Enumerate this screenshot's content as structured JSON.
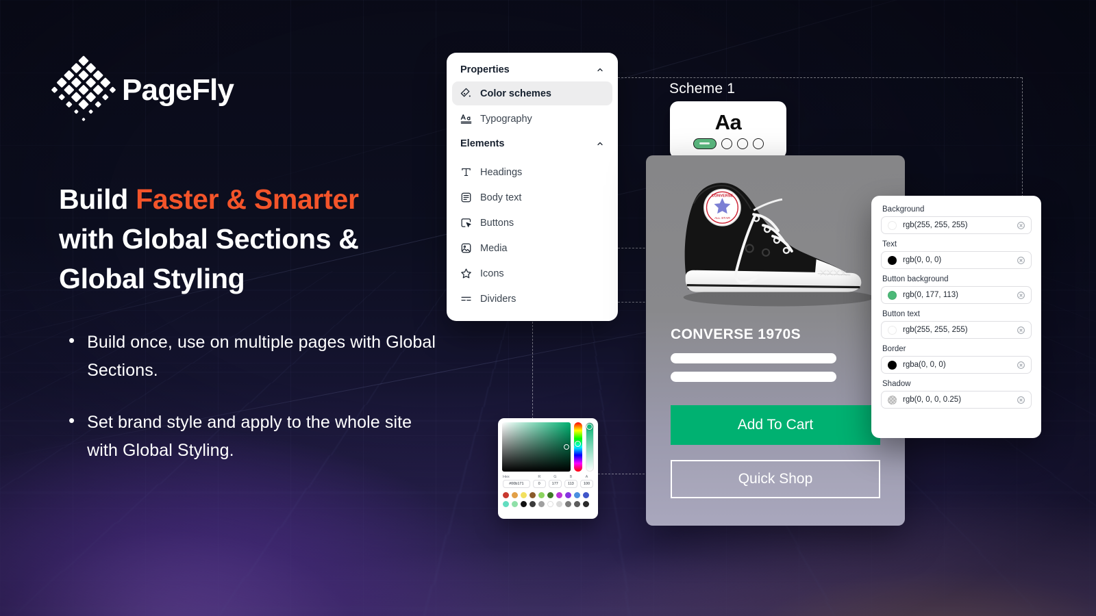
{
  "brand": {
    "name": "PageFly",
    "logo_icon": "pagefly-diamond-grid-icon",
    "accent_color": "#f3542a"
  },
  "hero": {
    "headline_part1": "Build ",
    "headline_accent": "Faster & Smarter",
    "headline_part2": "with Global Sections & Global Styling",
    "bullets": [
      "Build once, use on multiple pages with Global Sections.",
      "Set brand style and apply to the whole site with Global Styling."
    ]
  },
  "properties_panel": {
    "sections": [
      {
        "title": "Properties",
        "chevron": "chevron-up-icon"
      },
      {
        "title": "Elements",
        "chevron": "chevron-up-icon"
      }
    ],
    "properties_items": [
      {
        "label": "Color schemes",
        "icon": "color-swatch-icon",
        "active": true
      },
      {
        "label": "Typography",
        "icon": "typography-aa-icon",
        "active": false
      }
    ],
    "elements_items": [
      {
        "label": "Headings",
        "icon": "heading-t-icon"
      },
      {
        "label": "Body text",
        "icon": "body-text-icon"
      },
      {
        "label": "Buttons",
        "icon": "button-cursor-icon"
      },
      {
        "label": "Media",
        "icon": "image-icon"
      },
      {
        "label": "Icons",
        "icon": "star-icon"
      },
      {
        "label": "Dividers",
        "icon": "divider-lines-icon"
      }
    ]
  },
  "scheme": {
    "label": "Scheme 1",
    "preview_text": "Aa",
    "swatch_count": 4,
    "active_swatch_color": "#5bb87f"
  },
  "product_card": {
    "title": "CONVERSE 1970S",
    "image_alt": "converse-chuck-taylor-sneaker",
    "primary_button": "Add To Cart",
    "secondary_button": "Quick Shop",
    "primary_button_color": "#00b171"
  },
  "color_properties": {
    "fields": [
      {
        "label": "Background",
        "value": "rgb(255, 255, 255)",
        "swatch": "#ffffff",
        "swatch_style": "solid"
      },
      {
        "label": "Text",
        "value": "rgb(0, 0, 0)",
        "swatch": "#000000",
        "swatch_style": "solid"
      },
      {
        "label": "Button background",
        "value": "rgb(0, 177, 113)",
        "swatch": "#4cb978",
        "swatch_style": "solid"
      },
      {
        "label": "Button text",
        "value": "rgb(255, 255, 255)",
        "swatch": "#ffffff",
        "swatch_style": "solid"
      },
      {
        "label": "Border",
        "value": "rgba(0, 0, 0)",
        "swatch": "#000000",
        "swatch_style": "solid"
      },
      {
        "label": "Shadow",
        "value": "rgb(0, 0, 0, 0.25)",
        "swatch": "#b9b9b9",
        "swatch_style": "checker"
      }
    ],
    "clear_icon": "clear-circle-x-icon"
  },
  "color_picker": {
    "headers": [
      "Hex",
      "R",
      "G",
      "B",
      "A"
    ],
    "hex": "#00b171",
    "r": "0",
    "g": "177",
    "b": "113",
    "a": "100",
    "swatch_row_1": [
      "#c8382f",
      "#e2a047",
      "#f2e05e",
      "#8a5a2b",
      "#8bd45f",
      "#3d7a24",
      "#bb34d6",
      "#8733e0",
      "#4a8fe0",
      "#3f55c9"
    ],
    "swatch_row_2": [
      "#62ddc0",
      "#8fe0a8",
      "#111111",
      "#3a3a3a",
      "#a0a0a0",
      "#ffffff",
      "#d9d9d9",
      "#7b7b7b",
      "#5c5c5c",
      "#2a2a2a"
    ]
  }
}
